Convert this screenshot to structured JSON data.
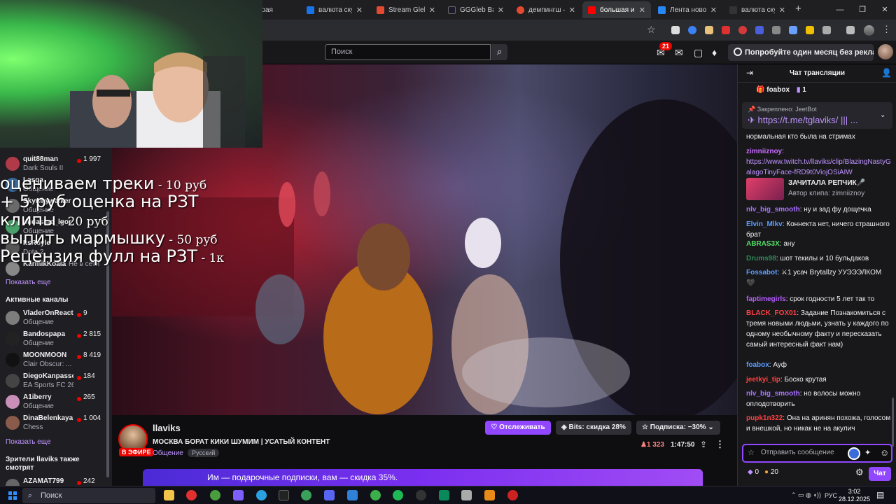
{
  "browser": {
    "tabs": [
      {
        "title": "ь упрая",
        "color": "#5f6368"
      },
      {
        "title": "валюта скучал",
        "color": "#1a73e8"
      },
      {
        "title": "Stream Gleb Bab",
        "color": "#e34a2f"
      },
      {
        "title": "GGGleb Babki",
        "color": "#1b1b2b"
      },
      {
        "title": "демпингш — У",
        "color": "#e34a2f"
      },
      {
        "title": "большая и ма",
        "color": "#ff0000"
      },
      {
        "title": "Лента новост",
        "color": "#2787f5"
      },
      {
        "title": "валюта скурп",
        "color": "#333333"
      }
    ],
    "new_tab": "+",
    "window_controls": [
      "—",
      "❐",
      "✕"
    ]
  },
  "topnav": {
    "search_placeholder": "Поиск",
    "notifications_count": "21",
    "promo_text": "Попробуйте один месяц без рекламы"
  },
  "webcam_overlay": {
    "lines": [
      {
        "text": "оцениваем треки",
        "price": " - 10 руб"
      },
      {
        "text": "+ 5 руб оценка на РЗТ",
        "price": ""
      },
      {
        "text": "клипы",
        "price": " - 20 руб"
      },
      {
        "text": "выпить мармышку",
        "price": " - 50 руб"
      },
      {
        "text": "Рецензия фулл на РЗТ",
        "price": " - 1к"
      }
    ]
  },
  "sidebar": {
    "followed": [
      {
        "name": "quit88man",
        "category": "Dark Souls II",
        "viewers": "1 997",
        "color": "#b03a48"
      },
      {
        "name": "Lasqa",
        "category": "Общение",
        "viewers": "",
        "color": "#3a6b9a"
      },
      {
        "name": "Skywhywalker",
        "category": "Общение",
        "viewers": "",
        "color": "#6a6a6a"
      },
      {
        "name": "dudasmo_lgor",
        "category": "Общение",
        "viewers": "",
        "color": "#4aa06a"
      },
      {
        "name": "ItsRoyle",
        "category": "Dota 2",
        "viewers": "",
        "color": "#555"
      },
      {
        "name": "KarmikKoala",
        "category": "",
        "viewers": "",
        "offline": "Не в сети",
        "color": "#888"
      }
    ],
    "show_more_1": "Показать еще",
    "active_header": "Активные каналы",
    "active": [
      {
        "name": "VladerOnReact",
        "category": "Общение",
        "viewers": "9",
        "color": "#7d7d7d"
      },
      {
        "name": "Bandospapa",
        "category": "Общение",
        "viewers": "2 815",
        "color": "#222"
      },
      {
        "name": "MOONMOON",
        "category": "Clair Obscur: ...",
        "viewers": "8 419",
        "color": "#111"
      },
      {
        "name": "DiegoKanpasso",
        "category": "EA Sports FC 26",
        "viewers": "184",
        "color": "#444"
      },
      {
        "name": "A1iberry",
        "category": "Общение",
        "viewers": "265",
        "color": "#c98fb8"
      },
      {
        "name": "DinaBelenkaya",
        "category": "Chess",
        "viewers": "1 004",
        "color": "#8a5a4a"
      }
    ],
    "show_more_2": "Показать еще",
    "also_watch_header": "Зрители llaviks также смотрят",
    "also_watch": [
      {
        "name": "AZAMAT799",
        "viewers": "242",
        "color": "#666"
      }
    ]
  },
  "stream": {
    "streamer": "llaviks",
    "title": "МОСКВА БОРАТ КИКИ ШУМИМ | УСАТЫЙ КОНТЕНТ",
    "category": "Общение",
    "tag": "Русский",
    "live_label": "В ЭФИРЕ",
    "follow_label": "Отслеживать",
    "bits_label": "Bits: скидка 28%",
    "sub_label": "Подписка: −30%",
    "viewers": "1 323",
    "uptime": "1:47:50",
    "banner_text": "Им — подарочные подписки, вам — скидка 35%."
  },
  "chat": {
    "title": "Чат трансляции",
    "top_gifter": "foabox",
    "top_gifter_count": "1",
    "pinned_label": "Закреплено: JeetBot",
    "pinned_text": "https://t.me/tglaviks/ ||| ...",
    "messages": [
      {
        "user": "",
        "color": "#efeff1",
        "text": "нормальная кто была на стримах"
      },
      {
        "user": "zimniiznoy",
        "color": "#c86bff",
        "text": "",
        "link": "https://www.twitch.tv/llaviks/clip/BlazingNastyGalagoTinyFace-fRD9t0ViojOSiAIW"
      },
      {
        "user": "nlv_big_smooth",
        "color": "#a970ff",
        "text": "ну и зад фу дощечка"
      },
      {
        "user": "Elvin_Mlkv",
        "color": "#5b9cff",
        "text": "Коннекта нет, ничего страшного брат"
      },
      {
        "user": "ABRAS3X",
        "color": "#54e066",
        "text": "ану"
      },
      {
        "user": "Drums98",
        "color": "#2e8b57",
        "text": "шот текилы и 10 бульдаков"
      },
      {
        "user": "Fossabot",
        "color": "#5b9cff",
        "text": "⚔1 усач Brytallzy УУЭЭЭЛКОМ 🖤"
      },
      {
        "user": "faptimegirls",
        "color": "#b65cff",
        "text": "срок годности 5 лет так то"
      },
      {
        "user": "BLACK_FOX01",
        "color": "#ff4040",
        "text": "Задание Познакомиться с тремя новыми людьми, узнать у каждого по одному необычному факту и пересказать самый интересный факт нам)"
      },
      {
        "user": "foabox",
        "color": "#5b9cff",
        "text": "Ауф"
      },
      {
        "user": "jeetkyi_tip",
        "color": "#ff4040",
        "text": "Боско крутая"
      },
      {
        "user": "nlv_big_smooth",
        "color": "#a970ff",
        "text": "но волосы можно оплодотворить"
      },
      {
        "user": "pupk1n322",
        "color": "#ff4040",
        "text": "Она на аринян похожа, голосом и внешкой, но никак не на акулич"
      }
    ],
    "clip_title": "ЗАЧИТАЛА РЕПЧИК🎤",
    "clip_author": "Автор клипа: zimniiznoy",
    "input_placeholder": "Отправить сообщение",
    "bits_count": "0",
    "points_count": "20",
    "chat_button": "Чат"
  },
  "taskbar": {
    "search_placeholder": "Поиск",
    "lang": "РУС",
    "time": "3:02",
    "date": "28.12.2025"
  }
}
